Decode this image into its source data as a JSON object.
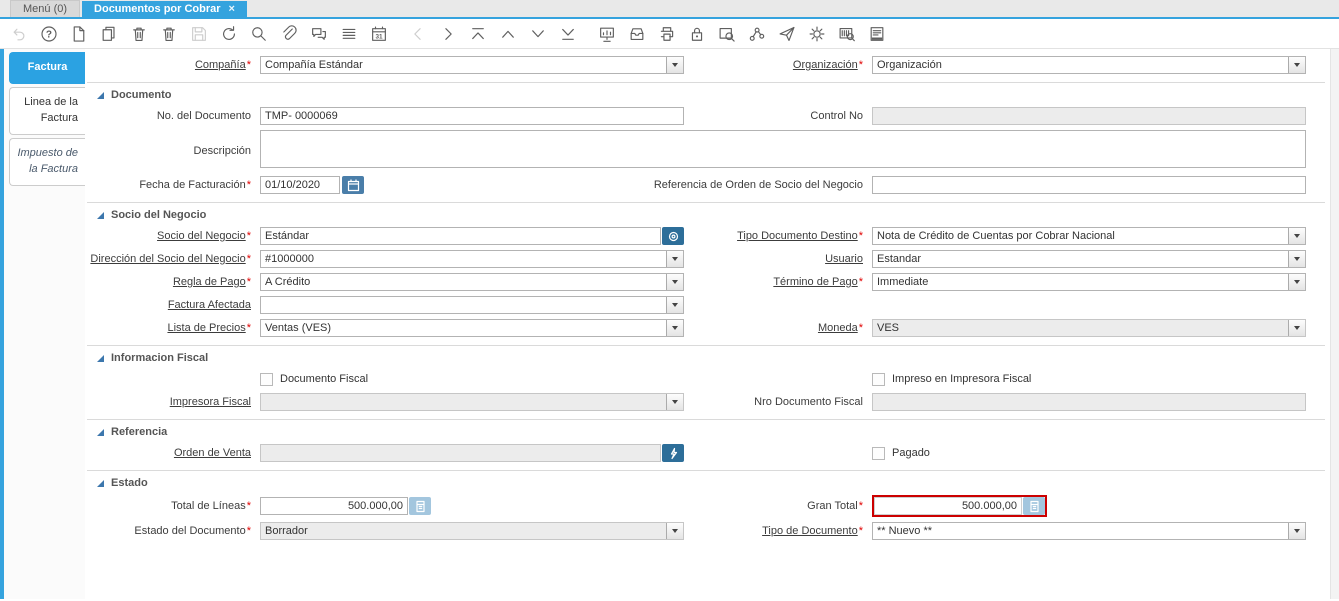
{
  "window": {
    "tabs": [
      {
        "label": "Menú (0)"
      },
      {
        "label": "Documentos por Cobrar",
        "active": true,
        "close_glyph": "×"
      }
    ]
  },
  "toolbar": {
    "icons": [
      {
        "name": "undo-icon",
        "disabled": true
      },
      {
        "name": "help-icon",
        "disabled": false
      },
      {
        "name": "new-record-icon",
        "disabled": false
      },
      {
        "name": "copy-record-icon",
        "disabled": false
      },
      {
        "name": "delete-record-icon",
        "disabled": false
      },
      {
        "name": "delete-selection-icon",
        "disabled": false
      },
      {
        "name": "save-icon",
        "disabled": true
      },
      {
        "name": "refresh-icon",
        "disabled": false
      },
      {
        "name": "find-icon",
        "disabled": false
      },
      {
        "name": "attachment-icon",
        "disabled": false
      },
      {
        "name": "chat-icon",
        "disabled": false
      },
      {
        "name": "grid-toggle-icon",
        "disabled": false
      },
      {
        "name": "calendar-icon",
        "disabled": false
      },
      {
        "name": "nav-left-icon",
        "disabled": true
      },
      {
        "name": "nav-right-icon",
        "disabled": false
      },
      {
        "name": "first-record-icon",
        "disabled": false
      },
      {
        "name": "previous-record-icon",
        "disabled": false
      },
      {
        "name": "next-record-icon",
        "disabled": false
      },
      {
        "name": "last-record-icon",
        "disabled": false
      },
      {
        "name": "report-icon",
        "disabled": false
      },
      {
        "name": "archive-icon",
        "disabled": false
      },
      {
        "name": "print-icon",
        "disabled": false
      },
      {
        "name": "lock-icon",
        "disabled": false
      },
      {
        "name": "zoom-across-icon",
        "disabled": false
      },
      {
        "name": "workflow-icon",
        "disabled": false
      },
      {
        "name": "send-mail-icon",
        "disabled": false
      },
      {
        "name": "process-icon",
        "disabled": false
      },
      {
        "name": "product-info-icon",
        "disabled": false
      },
      {
        "name": "report-view-icon",
        "disabled": false
      }
    ]
  },
  "sidebar": {
    "tabs": [
      {
        "label": "Factura",
        "active": true
      },
      {
        "label": "Linea de la Factura"
      },
      {
        "label": "Impuesto de la Factura",
        "italic": true
      }
    ]
  },
  "sections": {
    "documento": "Documento",
    "socio": "Socio del Negocio",
    "fiscal": "Informacion Fiscal",
    "referencia": "Referencia",
    "estado": "Estado"
  },
  "fields": {
    "compania": {
      "label": "Compañía",
      "value": "Compañía Estándar"
    },
    "organizacion": {
      "label": "Organización",
      "value": "Organización"
    },
    "no_documento": {
      "label": "No. del Documento",
      "value": "TMP- 0000069"
    },
    "control_no": {
      "label": "Control No",
      "value": ""
    },
    "descripcion": {
      "label": "Descripción",
      "value": ""
    },
    "fecha_facturacion": {
      "label": "Fecha de Facturación",
      "value": "01/10/2020"
    },
    "referencia_orden": {
      "label": "Referencia de Orden de Socio del Negocio",
      "value": ""
    },
    "socio_negocio": {
      "label": "Socio del Negocio",
      "value": "Estándar"
    },
    "tipo_doc_destino": {
      "label": "Tipo Documento Destino",
      "value": "Nota de Crédito de Cuentas por Cobrar Nacional"
    },
    "direccion_socio": {
      "label": "Dirección del Socio del Negocio",
      "value": "#1000000"
    },
    "usuario": {
      "label": "Usuario",
      "value": "Estandar"
    },
    "regla_pago": {
      "label": "Regla de Pago",
      "value": "A Crédito"
    },
    "termino_pago": {
      "label": "Término de Pago",
      "value": "Immediate"
    },
    "factura_afectada": {
      "label": "Factura Afectada",
      "value": ""
    },
    "lista_precios": {
      "label": "Lista de Precios",
      "value": "Ventas (VES)"
    },
    "moneda": {
      "label": "Moneda",
      "value": "VES"
    },
    "documento_fiscal": {
      "label": "Documento Fiscal",
      "checked": false
    },
    "impreso_fiscal": {
      "label": "Impreso en Impresora Fiscal",
      "checked": false
    },
    "impresora_fiscal": {
      "label": "Impresora Fiscal",
      "value": ""
    },
    "nro_doc_fiscal": {
      "label": "Nro Documento Fiscal",
      "value": ""
    },
    "orden_venta": {
      "label": "Orden de Venta",
      "value": ""
    },
    "pagado": {
      "label": "Pagado",
      "checked": false
    },
    "total_lineas": {
      "label": "Total de Líneas",
      "value": "500.000,00"
    },
    "gran_total": {
      "label": "Gran Total",
      "value": "500.000,00"
    },
    "estado_documento": {
      "label": "Estado del Documento",
      "value": "Borrador"
    },
    "tipo_documento": {
      "label": "Tipo de Documento",
      "value": "** Nuevo **"
    }
  },
  "misc": {
    "req": "*"
  },
  "colors": {
    "accent_blue": "#35a3de",
    "button_dark_blue": "#2d6e99",
    "date_button_blue": "#4a7ea9",
    "calc_button_pale_blue": "#a3c6de",
    "highlight_red": "#cc0000"
  }
}
